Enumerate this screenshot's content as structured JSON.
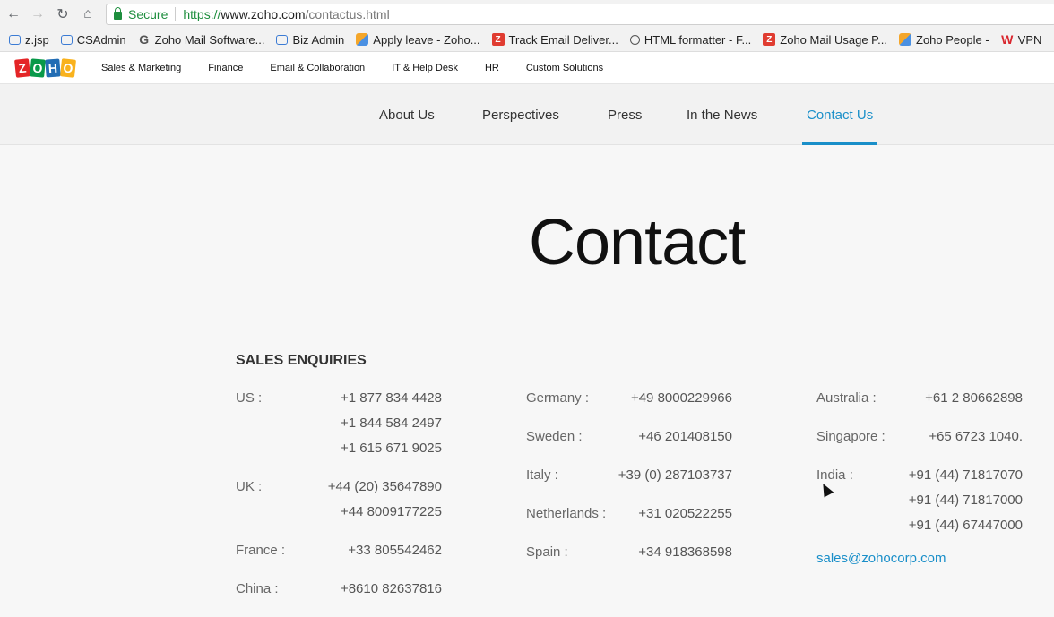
{
  "browser": {
    "secure_label": "Secure",
    "url_scheme": "https://",
    "url_host": "www.zoho.com",
    "url_path": "/contactus.html"
  },
  "bookmarks": [
    {
      "label": "z.jsp",
      "icon": "mail-icon"
    },
    {
      "label": "CSAdmin",
      "icon": "mail-icon"
    },
    {
      "label": "Zoho Mail Software...",
      "icon": "g-icon"
    },
    {
      "label": "Biz Admin",
      "icon": "mail-icon"
    },
    {
      "label": "Apply leave - Zoho...",
      "icon": "cube-icon"
    },
    {
      "label": "Track Email Deliver...",
      "icon": "z-icon"
    },
    {
      "label": "HTML formatter - F...",
      "icon": "clock-icon"
    },
    {
      "label": "Zoho Mail Usage P...",
      "icon": "z-icon"
    },
    {
      "label": "Zoho People -",
      "icon": "cube-icon"
    },
    {
      "label": "VPN",
      "icon": "vpn-icon"
    }
  ],
  "zoho_nav": {
    "logo_letters": [
      "Z",
      "O",
      "H",
      "O"
    ],
    "items": [
      "Sales & Marketing",
      "Finance",
      "Email & Collaboration",
      "IT & Help Desk",
      "HR",
      "Custom Solutions"
    ]
  },
  "sub_nav": {
    "items": [
      "About Us",
      "Perspectives",
      "Press",
      "In the News",
      "Contact Us"
    ],
    "active": "Contact Us"
  },
  "main": {
    "title": "Contact",
    "section_heading": "SALES ENQUIRIES",
    "columns": [
      {
        "entries": [
          {
            "country": "US :",
            "phones": [
              "+1 877 834 4428",
              "+1 844 584 2497",
              "+1 615 671 9025"
            ]
          },
          {
            "country": "UK :",
            "phones": [
              "+44 (20) 35647890",
              "+44 8009177225"
            ]
          },
          {
            "country": "France :",
            "phones": [
              "+33 805542462"
            ]
          },
          {
            "country": "China :",
            "phones": [
              "+8610 82637816"
            ]
          }
        ]
      },
      {
        "entries": [
          {
            "country": "Germany :",
            "phones": [
              "+49 8000229966"
            ]
          },
          {
            "country": "Sweden :",
            "phones": [
              "+46 201408150"
            ]
          },
          {
            "country": "Italy :",
            "phones": [
              "+39 (0) 287103737"
            ]
          },
          {
            "country": "Netherlands :",
            "phones": [
              "+31 020522255"
            ]
          },
          {
            "country": "Spain :",
            "phones": [
              "+34 918368598"
            ]
          }
        ]
      },
      {
        "entries": [
          {
            "country": "Australia :",
            "phones": [
              "+61 2 80662898"
            ]
          },
          {
            "country": "Singapore :",
            "phones": [
              "+65 6723 1040."
            ]
          },
          {
            "country": "India :",
            "phones": [
              "+91 (44) 71817070",
              "+91 (44) 71817000",
              "+91 (44) 67447000"
            ]
          }
        ],
        "email": "sales@zohocorp.com"
      }
    ]
  },
  "colors": {
    "accent": "#1a8fc9",
    "secure_green": "#1e8e3e"
  }
}
